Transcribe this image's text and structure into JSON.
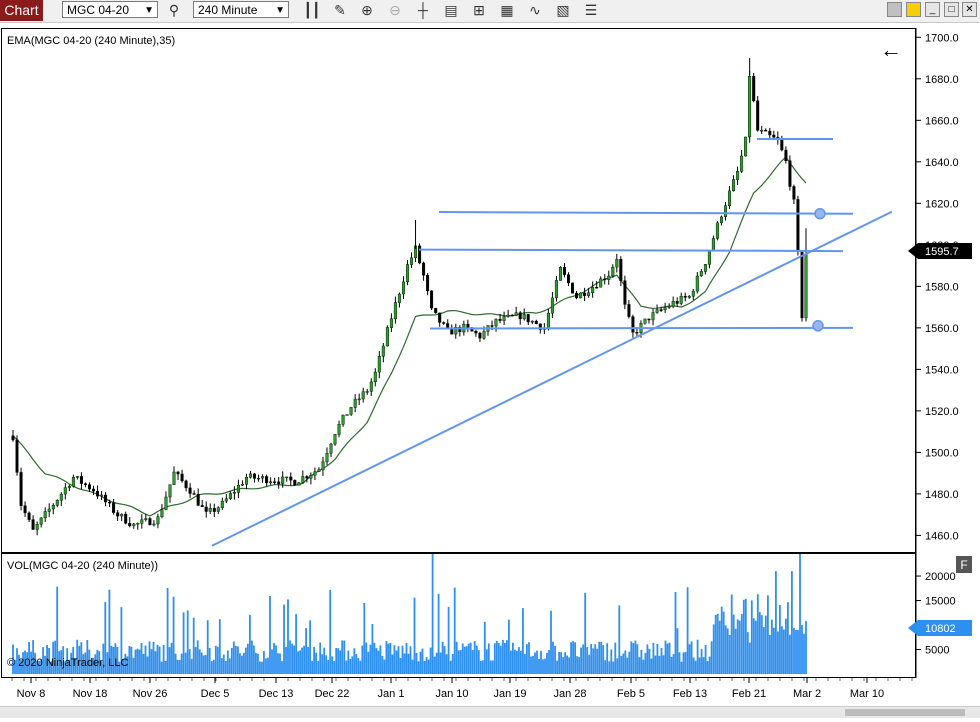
{
  "toolbar": {
    "chart_tab": "Chart",
    "instrument": "MGC 04-20",
    "interval": "240 Minute",
    "icons": [
      "search-icon",
      "bar-type-icon",
      "pencil-icon",
      "zoom-in-icon",
      "zoom-out-icon",
      "crosshair-icon",
      "properties-icon",
      "data-series-icon",
      "strategies-icon",
      "indicators-icon",
      "chart-trader-icon",
      "templates-icon",
      "list-icon"
    ],
    "window_icons": [
      "color-square-icon",
      "link-square-icon",
      "minimize-icon",
      "maximize-icon",
      "close-icon"
    ]
  },
  "price_panel": {
    "indicator_label": "EMA(MGC 04-20 (240 Minute),35)",
    "back_arrow": "←",
    "current_price": "1595.7",
    "y_ticks": [
      "1700.0",
      "1680.0",
      "1660.0",
      "1640.0",
      "1620.0",
      "1600.0",
      "1580.0",
      "1560.0",
      "1540.0",
      "1520.0",
      "1500.0",
      "1480.0",
      "1460.0"
    ]
  },
  "volume_panel": {
    "indicator_label": "VOL(MGC 04-20 (240 Minute))",
    "f_button": "F",
    "current_volume": "10802",
    "y_ticks": [
      "20000",
      "15000",
      "10000",
      "5000"
    ],
    "copyright": "© 2020 NinjaTrader, LLC"
  },
  "x_axis": {
    "labels": [
      "Nov 8",
      "Nov 18",
      "Nov 26",
      "Dec 5",
      "Dec 13",
      "Dec 22",
      "Jan 1",
      "Jan 10",
      "Jan 19",
      "Jan 28",
      "Feb 5",
      "Feb 13",
      "Feb 21",
      "Mar 2",
      "Mar 10"
    ]
  },
  "colors": {
    "candle_up": "#27a027",
    "candle_down": "#000000",
    "ema": "#2e6b2e",
    "drawing_lines": "#6495ed",
    "volume": "#2d8ff0",
    "chart_tab": "#8b1a1a"
  },
  "chart_data": [
    {
      "type": "line",
      "title": "",
      "series": [
        {
          "name": "EMA(MGC 04-20 (240 Minute),35)",
          "kind": "ema"
        },
        {
          "name": "",
          "kind": "close_path"
        }
      ],
      "x_labels": [
        "Nov 8",
        "Nov 18",
        "Nov 26",
        "Dec 5",
        "Dec 13",
        "Dec 22",
        "Jan 1",
        "Jan 10",
        "Jan 19",
        "Jan 28",
        "Feb 5",
        "Feb 13",
        "Feb 21",
        "Mar 2",
        "Mar 10"
      ],
      "close_anchors": [
        [
          0,
          1508
        ],
        [
          2,
          1475
        ],
        [
          5,
          1462
        ],
        [
          10,
          1475
        ],
        [
          15,
          1488
        ],
        [
          20,
          1482
        ],
        [
          26,
          1470
        ],
        [
          30,
          1465
        ],
        [
          36,
          1468
        ],
        [
          40,
          1490
        ],
        [
          44,
          1482
        ],
        [
          48,
          1470
        ],
        [
          52,
          1475
        ],
        [
          58,
          1488
        ],
        [
          64,
          1487
        ],
        [
          70,
          1486
        ],
        [
          76,
          1492
        ],
        [
          80,
          1510
        ],
        [
          84,
          1522
        ],
        [
          88,
          1530
        ],
        [
          90,
          1538
        ],
        [
          94,
          1565
        ],
        [
          98,
          1590
        ],
        [
          100,
          1598
        ],
        [
          102,
          1585
        ],
        [
          104,
          1568
        ],
        [
          108,
          1558
        ],
        [
          112,
          1560
        ],
        [
          116,
          1556
        ],
        [
          120,
          1563
        ],
        [
          126,
          1566
        ],
        [
          132,
          1560
        ],
        [
          136,
          1588
        ],
        [
          140,
          1575
        ],
        [
          144,
          1580
        ],
        [
          148,
          1586
        ],
        [
          150,
          1594
        ],
        [
          152,
          1570
        ],
        [
          154,
          1557
        ],
        [
          158,
          1565
        ],
        [
          164,
          1572
        ],
        [
          168,
          1575
        ],
        [
          172,
          1592
        ],
        [
          176,
          1615
        ],
        [
          180,
          1635
        ],
        [
          182,
          1650
        ],
        [
          183,
          1682
        ],
        [
          185,
          1655
        ],
        [
          190,
          1650
        ],
        [
          192,
          1640
        ],
        [
          194,
          1620
        ],
        [
          195,
          1595
        ],
        [
          196,
          1566
        ],
        [
          197,
          1596
        ]
      ],
      "ema_anchors": [
        [
          0,
          1508
        ],
        [
          8,
          1490
        ],
        [
          20,
          1480
        ],
        [
          34,
          1470
        ],
        [
          46,
          1479
        ],
        [
          60,
          1483
        ],
        [
          72,
          1485
        ],
        [
          80,
          1497
        ],
        [
          88,
          1515
        ],
        [
          94,
          1538
        ],
        [
          100,
          1565
        ],
        [
          108,
          1568
        ],
        [
          120,
          1566
        ],
        [
          130,
          1567
        ],
        [
          140,
          1576
        ],
        [
          150,
          1586
        ],
        [
          156,
          1570
        ],
        [
          166,
          1570
        ],
        [
          172,
          1577
        ],
        [
          178,
          1597
        ],
        [
          184,
          1625
        ],
        [
          192,
          1642
        ],
        [
          197,
          1630
        ]
      ],
      "y_range": [
        1452,
        1704
      ],
      "horizontal_lines": [
        1615,
        1597,
        1651,
        1560
      ],
      "trendline": {
        "from": [
          "Dec 5",
          1455
        ],
        "to": [
          "Mar 10",
          1616
        ]
      },
      "current_price": 1595.7
    },
    {
      "type": "bar",
      "title": "",
      "series": [
        {
          "name": "VOL(MGC 04-20 (240 Minute))"
        }
      ],
      "y_range": [
        0,
        24500
      ],
      "last_value": 10802
    }
  ]
}
